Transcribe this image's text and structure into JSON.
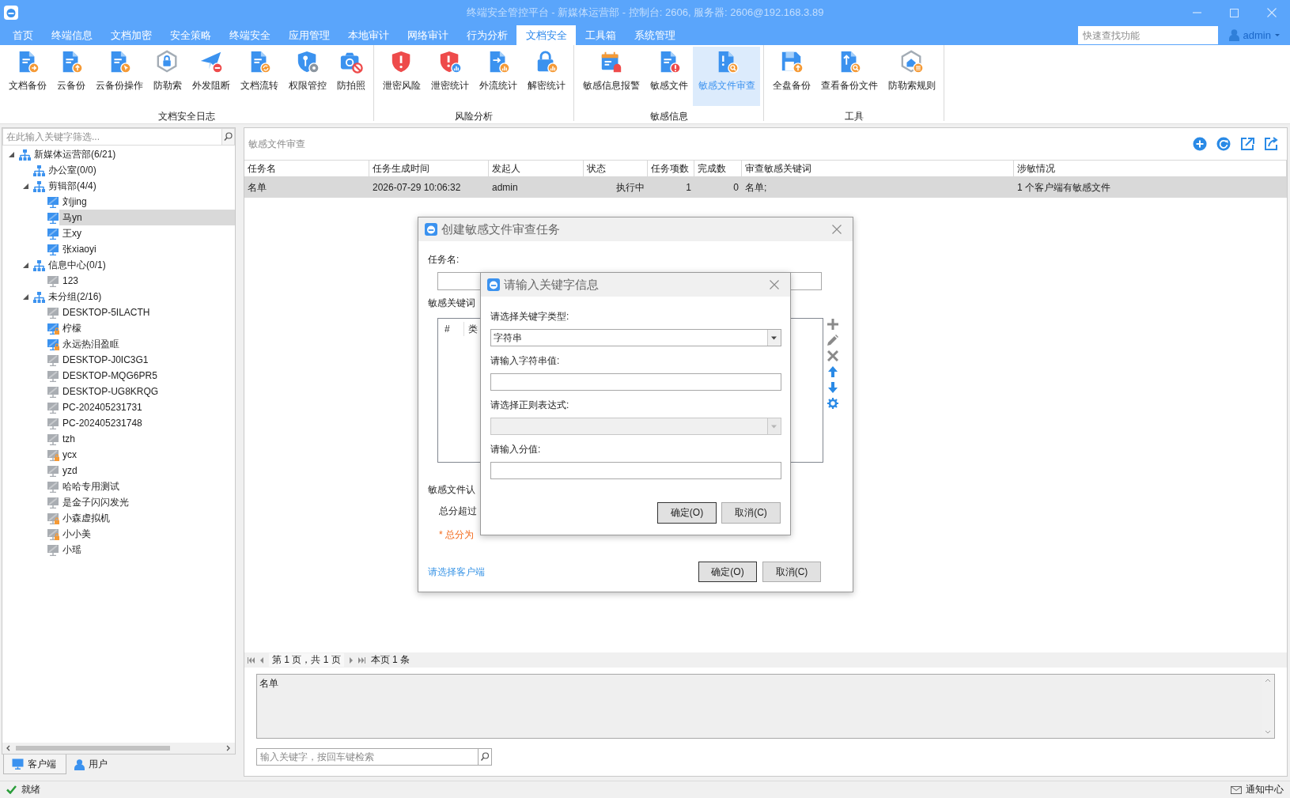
{
  "window": {
    "title": "终端安全管控平台 - 新媒体运营部 - 控制台: 2606, 服务器: 2606@192.168.3.89"
  },
  "menu": [
    {
      "label": "首页",
      "selected": false
    },
    {
      "label": "终端信息",
      "selected": false
    },
    {
      "label": "文档加密",
      "selected": false
    },
    {
      "label": "安全策略",
      "selected": false
    },
    {
      "label": "终端安全",
      "selected": false
    },
    {
      "label": "应用管理",
      "selected": false
    },
    {
      "label": "本地审计",
      "selected": false
    },
    {
      "label": "网络审计",
      "selected": false
    },
    {
      "label": "行为分析",
      "selected": false
    },
    {
      "label": "文档安全",
      "selected": true
    },
    {
      "label": "工具箱",
      "selected": false
    },
    {
      "label": "系统管理",
      "selected": false
    }
  ],
  "quick_search": {
    "placeholder": "快速查找功能"
  },
  "user": {
    "name": "admin"
  },
  "ribbon": [
    {
      "label": "文档安全日志",
      "buttons": [
        {
          "label": "文档备份",
          "selected": false
        },
        {
          "label": "云备份",
          "selected": false
        },
        {
          "label": "云备份操作",
          "selected": false
        },
        {
          "label": "防勒索",
          "selected": false
        },
        {
          "label": "外发阻断",
          "selected": false
        },
        {
          "label": "文档流转",
          "selected": false
        },
        {
          "label": "权限管控",
          "selected": false
        },
        {
          "label": "防拍照",
          "selected": false
        }
      ]
    },
    {
      "label": "风险分析",
      "buttons": [
        {
          "label": "泄密风险",
          "selected": false
        },
        {
          "label": "泄密统计",
          "selected": false
        },
        {
          "label": "外流统计",
          "selected": false
        },
        {
          "label": "解密统计",
          "selected": false
        }
      ]
    },
    {
      "label": "敏感信息",
      "buttons": [
        {
          "label": "敏感信息报警",
          "selected": false
        },
        {
          "label": "敏感文件",
          "selected": false
        },
        {
          "label": "敏感文件审查",
          "selected": true
        }
      ]
    },
    {
      "label": "工具",
      "buttons": [
        {
          "label": "全盘备份",
          "selected": false
        },
        {
          "label": "查看备份文件",
          "selected": false
        },
        {
          "label": "防勒索规则",
          "selected": false
        }
      ]
    }
  ],
  "sidebar": {
    "filter": {
      "placeholder": "在此输入关键字筛选..."
    },
    "tree": [
      {
        "label": "新媒体运营部(6/21)",
        "kind": "group",
        "expanded": true,
        "selected": false,
        "children": [
          {
            "label": "办公室(0/0)",
            "kind": "group",
            "selected": false
          },
          {
            "label": "剪辑部(4/4)",
            "kind": "group",
            "expanded": true,
            "selected": false,
            "children": [
              {
                "label": "刘jing",
                "kind": "computer",
                "online": true,
                "locked": false,
                "selected": false
              },
              {
                "label": "马yn",
                "kind": "computer",
                "online": true,
                "locked": false,
                "selected": true
              },
              {
                "label": "王xy",
                "kind": "computer",
                "online": true,
                "locked": false,
                "selected": false
              },
              {
                "label": "张xiaoyi",
                "kind": "computer",
                "online": true,
                "locked": false,
                "selected": false
              }
            ]
          },
          {
            "label": "信息中心(0/1)",
            "kind": "group",
            "expanded": true,
            "selected": false,
            "children": [
              {
                "label": "123",
                "kind": "computer",
                "online": false,
                "locked": false,
                "selected": false
              }
            ]
          },
          {
            "label": "未分组(2/16)",
            "kind": "group",
            "expanded": true,
            "selected": false,
            "children": [
              {
                "label": "DESKTOP-5ILACTH",
                "kind": "computer",
                "online": false,
                "locked": false,
                "selected": false
              },
              {
                "label": "柠檬",
                "kind": "computer",
                "online": true,
                "locked": true,
                "selected": false
              },
              {
                "label": "永远热泪盈眶",
                "kind": "computer",
                "online": true,
                "locked": true,
                "selected": false
              },
              {
                "label": "DESKTOP-J0IC3G1",
                "kind": "computer",
                "online": false,
                "locked": false,
                "selected": false
              },
              {
                "label": "DESKTOP-MQG6PR5",
                "kind": "computer",
                "online": false,
                "locked": false,
                "selected": false
              },
              {
                "label": "DESKTOP-UG8KRQG",
                "kind": "computer",
                "online": false,
                "locked": false,
                "selected": false
              },
              {
                "label": "PC-202405231731",
                "kind": "computer",
                "online": false,
                "locked": false,
                "selected": false
              },
              {
                "label": "PC-202405231748",
                "kind": "computer",
                "online": false,
                "locked": false,
                "selected": false
              },
              {
                "label": "tzh",
                "kind": "computer",
                "online": false,
                "locked": false,
                "selected": false
              },
              {
                "label": "ycx",
                "kind": "computer",
                "online": false,
                "locked": true,
                "selected": false
              },
              {
                "label": "yzd",
                "kind": "computer",
                "online": false,
                "locked": false,
                "selected": false
              },
              {
                "label": "哈哈专用测试",
                "kind": "computer",
                "online": false,
                "locked": false,
                "selected": false
              },
              {
                "label": "是金子闪闪发光",
                "kind": "computer",
                "online": false,
                "locked": false,
                "selected": false
              },
              {
                "label": "小森虚拟机",
                "kind": "computer",
                "online": false,
                "locked": true,
                "selected": false
              },
              {
                "label": "小小美",
                "kind": "computer",
                "online": false,
                "locked": true,
                "selected": false
              },
              {
                "label": "小瑶",
                "kind": "computer",
                "online": false,
                "locked": false,
                "selected": false
              }
            ]
          }
        ]
      }
    ],
    "tabs": [
      {
        "label": "客户端",
        "selected": true
      },
      {
        "label": "用户",
        "selected": false
      }
    ]
  },
  "content": {
    "title": "敏感文件审查",
    "table": {
      "columns": [
        "任务名",
        "任务生成时间",
        "发起人",
        "状态",
        "任务项数",
        "完成数",
        "审查敏感关键词",
        "涉敏情况"
      ],
      "rows": [
        {
          "cells": [
            "名单",
            "2026-07-29 10:06:32",
            "admin",
            "执行中",
            "1",
            "0",
            "名单;",
            "1 个客户端有敏感文件"
          ],
          "selected": true
        }
      ]
    },
    "pagination": {
      "page": "第 1 页，共 1 页",
      "count": "本页 1 条"
    },
    "detail": {
      "value": "名单"
    },
    "search": {
      "placeholder": "输入关键字，按回车键检索"
    }
  },
  "task_dialog": {
    "title": "创建敏感文件审查任务",
    "task_name_label": "任务名:",
    "keyword_list_label": "敏感关键词",
    "keyword_columns": [
      "#",
      "类"
    ],
    "criteria_label": "敏感文件认",
    "threshold_label": "总分超过",
    "note": "* 总分为",
    "client_link": "请选择客户端",
    "buttons": [
      {
        "label": "确定(O)",
        "default": true
      },
      {
        "label": "取消(C)",
        "default": false
      }
    ]
  },
  "keyword_dialog": {
    "title": "请输入关键字信息",
    "fields": [
      {
        "label": "请选择关键字类型:",
        "kind": "select",
        "value": "字符串",
        "disabled": false
      },
      {
        "label": "请输入字符串值:",
        "kind": "text",
        "disabled": false
      },
      {
        "label": "请选择正则表达式:",
        "kind": "select",
        "disabled": true
      },
      {
        "label": "请输入分值:",
        "kind": "text",
        "disabled": false
      }
    ],
    "buttons": [
      {
        "label": "确定(O)",
        "default": true
      },
      {
        "label": "取消(C)",
        "default": false
      }
    ]
  },
  "status_bar": {
    "status": "就绪",
    "notifications": "通知中心"
  }
}
